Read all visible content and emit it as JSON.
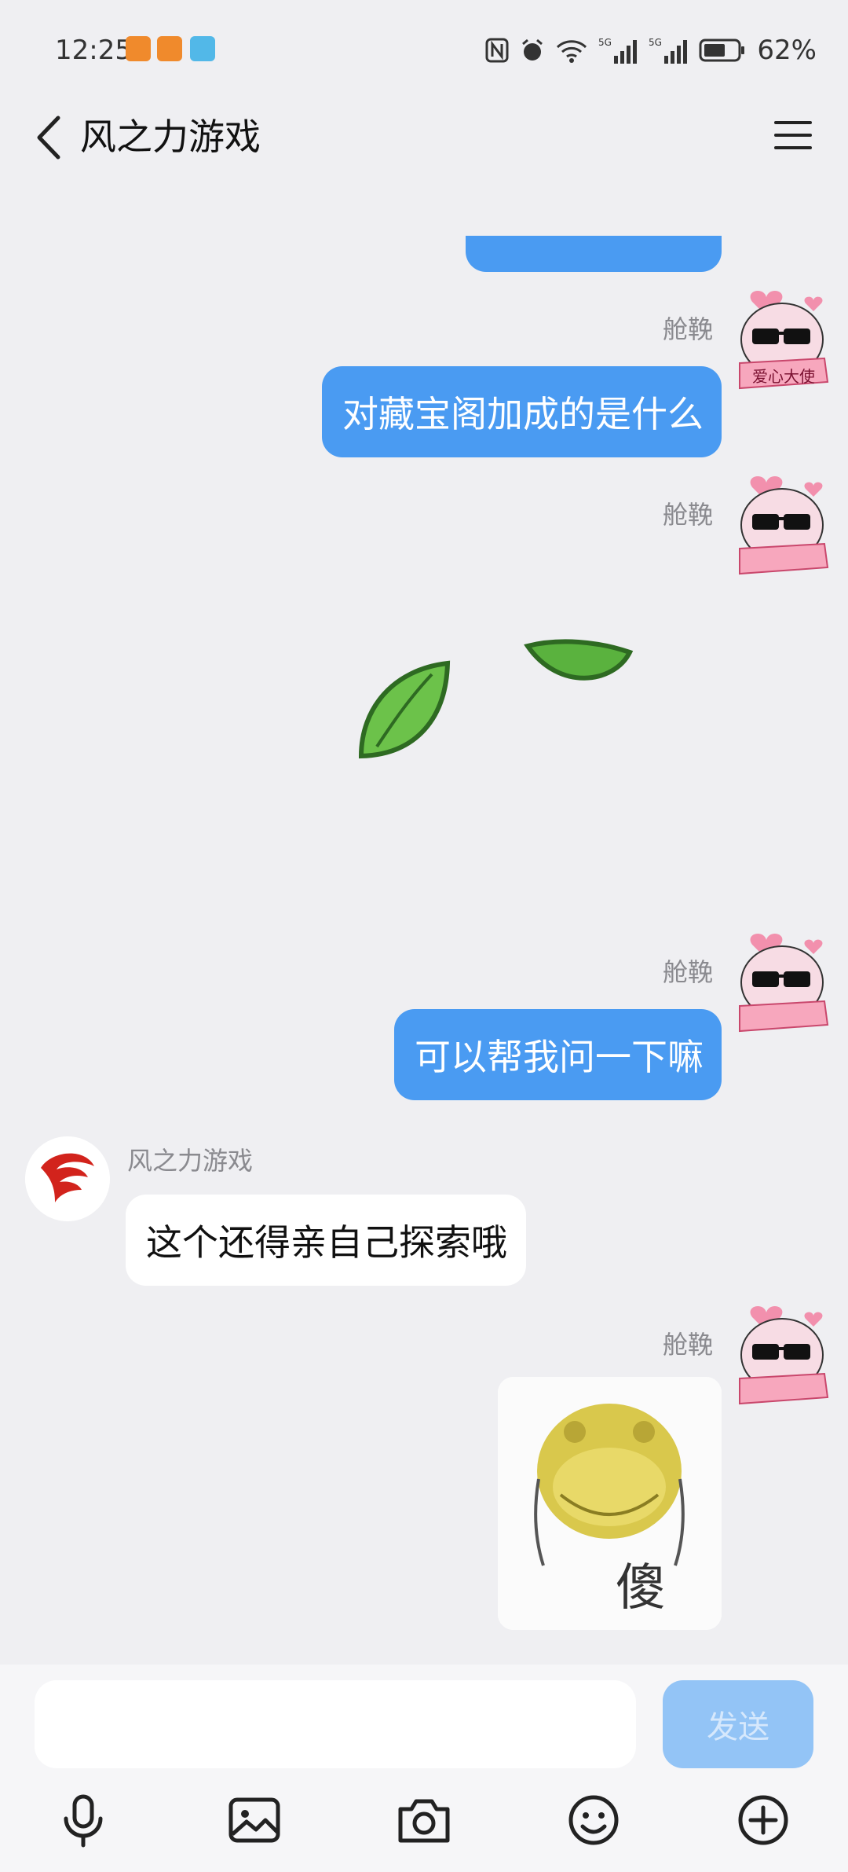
{
  "status_bar": {
    "time": "12:25",
    "battery": "62%",
    "network_labels": [
      "5G",
      "5G"
    ]
  },
  "header": {
    "title": "风之力游戏"
  },
  "messages": [
    {
      "sender": "舱鞔",
      "text": "对藏宝阁加成的是什么"
    },
    {
      "sender": "舱鞔"
    },
    {
      "sender": "舱鞔",
      "text": "可以帮我问一下嘛"
    },
    {
      "sender": "风之力游戏",
      "text": "这个还得亲自己探索哦"
    },
    {
      "sender": "舱鞔",
      "sticker_text": "傻"
    }
  ],
  "avatar_me_badge": "爱心大使",
  "composer": {
    "placeholder": "",
    "send_label": "发送"
  },
  "toolbar": [
    "microphone-icon",
    "image-icon",
    "camera-icon",
    "emoji-icon",
    "plus-icon"
  ],
  "colors": {
    "my_bubble": "#4a9bf2",
    "send_disabled": "#93c4f6",
    "background": "#efeff2"
  }
}
